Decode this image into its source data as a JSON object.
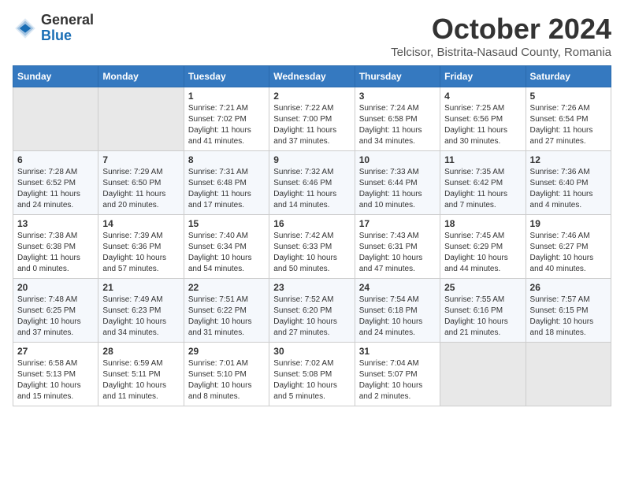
{
  "header": {
    "logo_general": "General",
    "logo_blue": "Blue",
    "month_title": "October 2024",
    "location": "Telcisor, Bistrita-Nasaud County, Romania"
  },
  "calendar": {
    "weekdays": [
      "Sunday",
      "Monday",
      "Tuesday",
      "Wednesday",
      "Thursday",
      "Friday",
      "Saturday"
    ],
    "weeks": [
      [
        {
          "day": "",
          "info": ""
        },
        {
          "day": "",
          "info": ""
        },
        {
          "day": "1",
          "info": "Sunrise: 7:21 AM\nSunset: 7:02 PM\nDaylight: 11 hours and 41 minutes."
        },
        {
          "day": "2",
          "info": "Sunrise: 7:22 AM\nSunset: 7:00 PM\nDaylight: 11 hours and 37 minutes."
        },
        {
          "day": "3",
          "info": "Sunrise: 7:24 AM\nSunset: 6:58 PM\nDaylight: 11 hours and 34 minutes."
        },
        {
          "day": "4",
          "info": "Sunrise: 7:25 AM\nSunset: 6:56 PM\nDaylight: 11 hours and 30 minutes."
        },
        {
          "day": "5",
          "info": "Sunrise: 7:26 AM\nSunset: 6:54 PM\nDaylight: 11 hours and 27 minutes."
        }
      ],
      [
        {
          "day": "6",
          "info": "Sunrise: 7:28 AM\nSunset: 6:52 PM\nDaylight: 11 hours and 24 minutes."
        },
        {
          "day": "7",
          "info": "Sunrise: 7:29 AM\nSunset: 6:50 PM\nDaylight: 11 hours and 20 minutes."
        },
        {
          "day": "8",
          "info": "Sunrise: 7:31 AM\nSunset: 6:48 PM\nDaylight: 11 hours and 17 minutes."
        },
        {
          "day": "9",
          "info": "Sunrise: 7:32 AM\nSunset: 6:46 PM\nDaylight: 11 hours and 14 minutes."
        },
        {
          "day": "10",
          "info": "Sunrise: 7:33 AM\nSunset: 6:44 PM\nDaylight: 11 hours and 10 minutes."
        },
        {
          "day": "11",
          "info": "Sunrise: 7:35 AM\nSunset: 6:42 PM\nDaylight: 11 hours and 7 minutes."
        },
        {
          "day": "12",
          "info": "Sunrise: 7:36 AM\nSunset: 6:40 PM\nDaylight: 11 hours and 4 minutes."
        }
      ],
      [
        {
          "day": "13",
          "info": "Sunrise: 7:38 AM\nSunset: 6:38 PM\nDaylight: 11 hours and 0 minutes."
        },
        {
          "day": "14",
          "info": "Sunrise: 7:39 AM\nSunset: 6:36 PM\nDaylight: 10 hours and 57 minutes."
        },
        {
          "day": "15",
          "info": "Sunrise: 7:40 AM\nSunset: 6:34 PM\nDaylight: 10 hours and 54 minutes."
        },
        {
          "day": "16",
          "info": "Sunrise: 7:42 AM\nSunset: 6:33 PM\nDaylight: 10 hours and 50 minutes."
        },
        {
          "day": "17",
          "info": "Sunrise: 7:43 AM\nSunset: 6:31 PM\nDaylight: 10 hours and 47 minutes."
        },
        {
          "day": "18",
          "info": "Sunrise: 7:45 AM\nSunset: 6:29 PM\nDaylight: 10 hours and 44 minutes."
        },
        {
          "day": "19",
          "info": "Sunrise: 7:46 AM\nSunset: 6:27 PM\nDaylight: 10 hours and 40 minutes."
        }
      ],
      [
        {
          "day": "20",
          "info": "Sunrise: 7:48 AM\nSunset: 6:25 PM\nDaylight: 10 hours and 37 minutes."
        },
        {
          "day": "21",
          "info": "Sunrise: 7:49 AM\nSunset: 6:23 PM\nDaylight: 10 hours and 34 minutes."
        },
        {
          "day": "22",
          "info": "Sunrise: 7:51 AM\nSunset: 6:22 PM\nDaylight: 10 hours and 31 minutes."
        },
        {
          "day": "23",
          "info": "Sunrise: 7:52 AM\nSunset: 6:20 PM\nDaylight: 10 hours and 27 minutes."
        },
        {
          "day": "24",
          "info": "Sunrise: 7:54 AM\nSunset: 6:18 PM\nDaylight: 10 hours and 24 minutes."
        },
        {
          "day": "25",
          "info": "Sunrise: 7:55 AM\nSunset: 6:16 PM\nDaylight: 10 hours and 21 minutes."
        },
        {
          "day": "26",
          "info": "Sunrise: 7:57 AM\nSunset: 6:15 PM\nDaylight: 10 hours and 18 minutes."
        }
      ],
      [
        {
          "day": "27",
          "info": "Sunrise: 6:58 AM\nSunset: 5:13 PM\nDaylight: 10 hours and 15 minutes."
        },
        {
          "day": "28",
          "info": "Sunrise: 6:59 AM\nSunset: 5:11 PM\nDaylight: 10 hours and 11 minutes."
        },
        {
          "day": "29",
          "info": "Sunrise: 7:01 AM\nSunset: 5:10 PM\nDaylight: 10 hours and 8 minutes."
        },
        {
          "day": "30",
          "info": "Sunrise: 7:02 AM\nSunset: 5:08 PM\nDaylight: 10 hours and 5 minutes."
        },
        {
          "day": "31",
          "info": "Sunrise: 7:04 AM\nSunset: 5:07 PM\nDaylight: 10 hours and 2 minutes."
        },
        {
          "day": "",
          "info": ""
        },
        {
          "day": "",
          "info": ""
        }
      ]
    ]
  }
}
